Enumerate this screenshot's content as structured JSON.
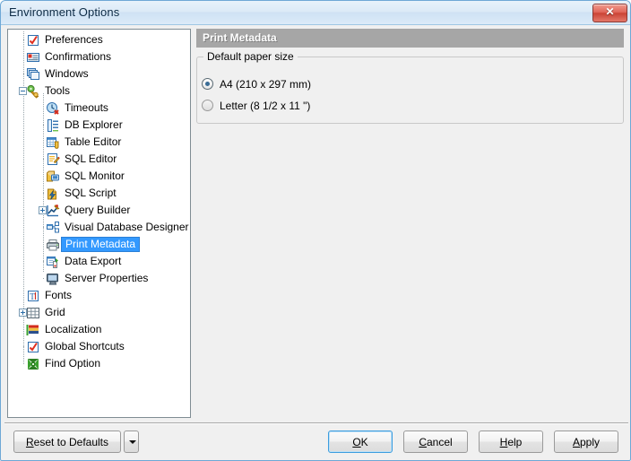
{
  "window": {
    "title": "Environment Options",
    "close_label": "✕",
    "close_icon": "close-icon"
  },
  "tree": {
    "items": [
      {
        "label": "Preferences",
        "indent": 0,
        "icon": "checkbox-red-check-icon",
        "expander": "none",
        "selected": false
      },
      {
        "label": "Confirmations",
        "indent": 0,
        "icon": "dialog-message-icon",
        "expander": "none",
        "selected": false
      },
      {
        "label": "Windows",
        "indent": 0,
        "icon": "windows-cascade-icon",
        "expander": "none",
        "selected": false
      },
      {
        "label": "Tools",
        "indent": 0,
        "icon": "tools-gear-icon",
        "expander": "minus",
        "selected": false
      },
      {
        "label": "Timeouts",
        "indent": 1,
        "icon": "clock-timeout-icon",
        "expander": "none",
        "selected": false
      },
      {
        "label": "DB Explorer",
        "indent": 1,
        "icon": "db-explorer-tree-icon",
        "expander": "none",
        "selected": false
      },
      {
        "label": "Table Editor",
        "indent": 1,
        "icon": "table-editor-grid-icon",
        "expander": "none",
        "selected": false
      },
      {
        "label": "SQL Editor",
        "indent": 1,
        "icon": "sql-editor-pencil-icon",
        "expander": "none",
        "selected": false
      },
      {
        "label": "SQL Monitor",
        "indent": 1,
        "icon": "sql-monitor-screen-icon",
        "expander": "none",
        "selected": false
      },
      {
        "label": "SQL Script",
        "indent": 1,
        "icon": "sql-script-lightning-icon",
        "expander": "none",
        "selected": false
      },
      {
        "label": "Query Builder",
        "indent": 1,
        "icon": "query-builder-chart-icon",
        "expander": "plus",
        "selected": false
      },
      {
        "label": "Visual Database Designer",
        "indent": 1,
        "icon": "visual-db-designer-icon",
        "expander": "none",
        "selected": false
      },
      {
        "label": "Print Metadata",
        "indent": 1,
        "icon": "printer-icon",
        "expander": "none",
        "selected": true
      },
      {
        "label": "Data Export",
        "indent": 1,
        "icon": "data-export-icon",
        "expander": "none",
        "selected": false
      },
      {
        "label": "Server Properties",
        "indent": 1,
        "icon": "server-monitor-icon",
        "expander": "none",
        "selected": false
      },
      {
        "label": "Fonts",
        "indent": 0,
        "icon": "font-ti-icon",
        "expander": "none",
        "selected": false
      },
      {
        "label": "Grid",
        "indent": 0,
        "icon": "grid-icon",
        "expander": "plus",
        "selected": false
      },
      {
        "label": "Localization",
        "indent": 0,
        "icon": "localization-flag-icon",
        "expander": "none",
        "selected": false
      },
      {
        "label": "Global Shortcuts",
        "indent": 0,
        "icon": "checkbox-red-check-icon",
        "expander": "none",
        "selected": false
      },
      {
        "label": "Find Option",
        "indent": 0,
        "icon": "find-option-icon",
        "expander": "none",
        "selected": false
      }
    ]
  },
  "content": {
    "header": "Print Metadata",
    "group_title": "Default paper size",
    "options": [
      {
        "label": "A4 (210 x 297 mm)",
        "checked": true
      },
      {
        "label": "Letter (8 1/2 x 11 \")",
        "checked": false
      }
    ]
  },
  "buttons": {
    "reset": {
      "pre": "R",
      "post": "eset to Defaults"
    },
    "reset_dropdown_icon": "chevron-down-icon",
    "ok": {
      "pre": "O",
      "post": "K"
    },
    "cancel": {
      "pre": "C",
      "post": "ancel"
    },
    "help": {
      "pre": "H",
      "post": "elp"
    },
    "apply": {
      "pre": "A",
      "post": "pply"
    }
  },
  "colors": {
    "selection": "#3399ff",
    "header_bar": "#a6a6a6",
    "window_border": "#6ea8d6",
    "close_button": "#ca4334"
  }
}
